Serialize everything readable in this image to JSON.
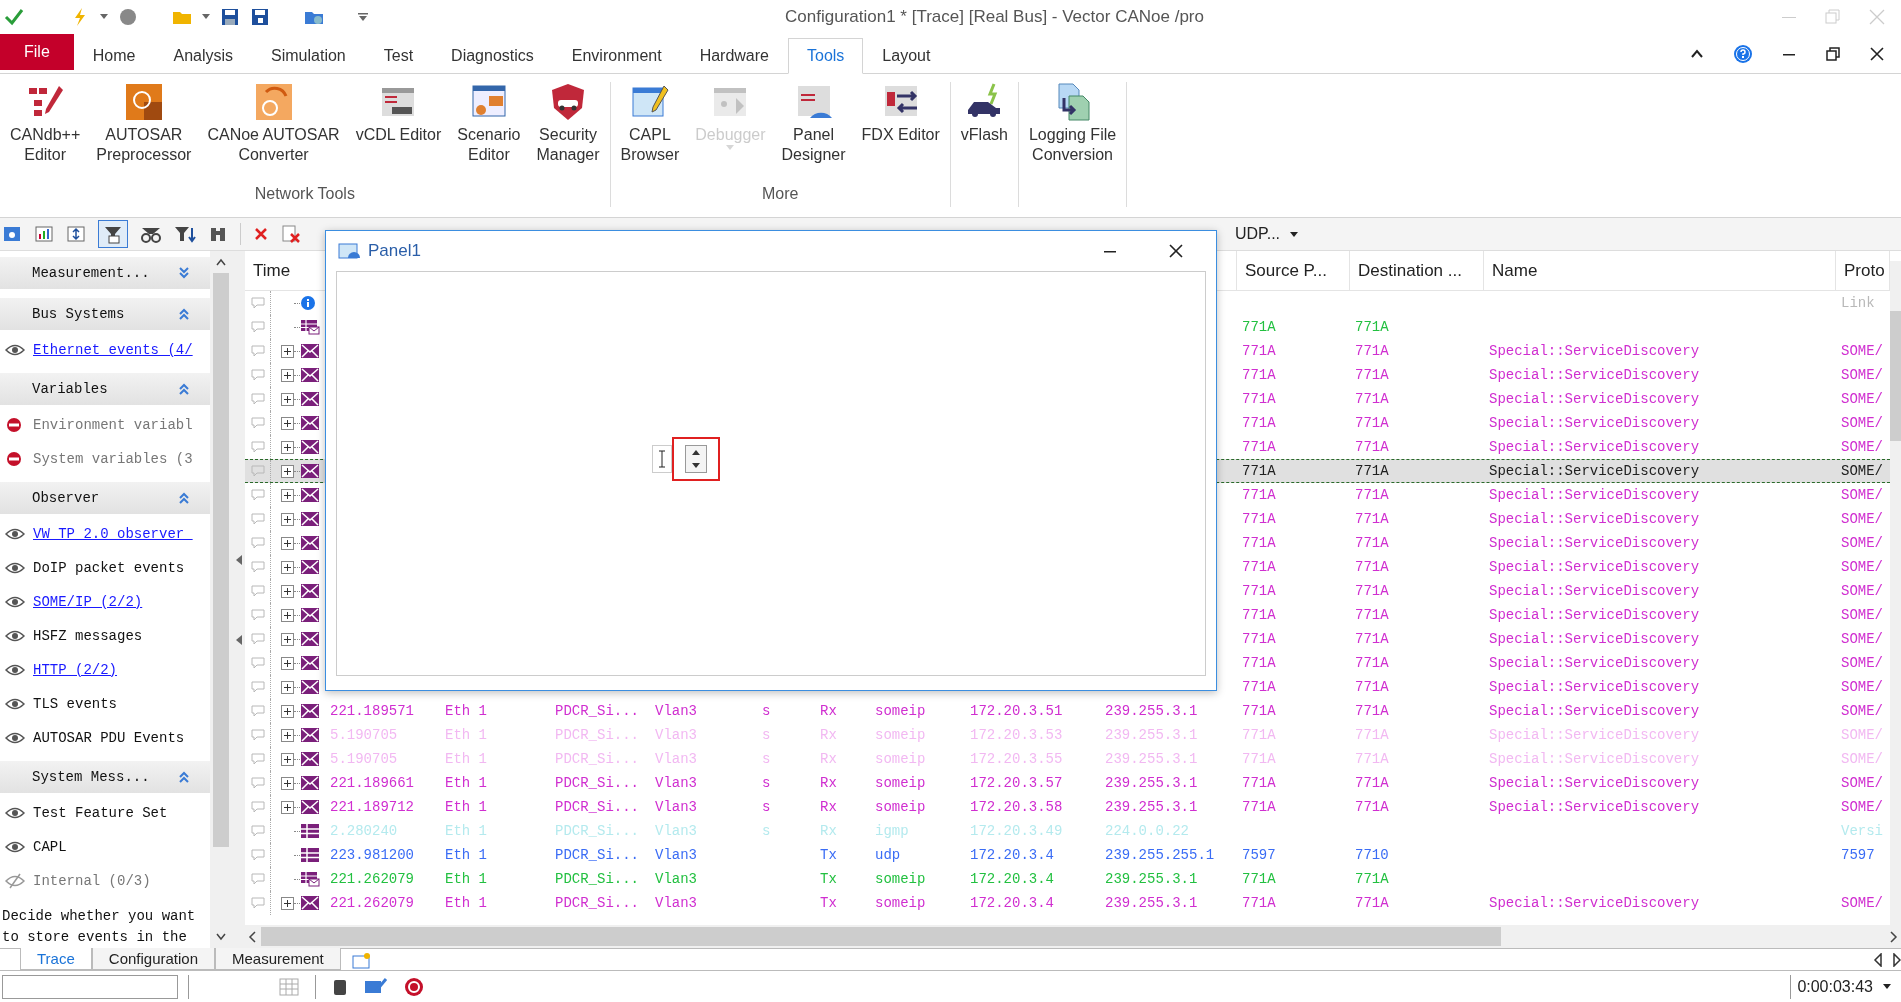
{
  "title_bar": {
    "title": "Configuration1 * [Trace] [Real Bus] - Vector CANoe /pro"
  },
  "ribbon_tabs": [
    {
      "label": "File",
      "kind": "backstage",
      "selected": false
    },
    {
      "label": "Home",
      "kind": "tab",
      "selected": false
    },
    {
      "label": "Analysis",
      "kind": "tab",
      "selected": false
    },
    {
      "label": "Simulation",
      "kind": "tab",
      "selected": false
    },
    {
      "label": "Test",
      "kind": "tab",
      "selected": false
    },
    {
      "label": "Diagnostics",
      "kind": "tab",
      "selected": false
    },
    {
      "label": "Environment",
      "kind": "tab",
      "selected": false
    },
    {
      "label": "Hardware",
      "kind": "tab",
      "selected": false
    },
    {
      "label": "Tools",
      "kind": "tab",
      "selected": true
    },
    {
      "label": "Layout",
      "kind": "tab",
      "selected": false
    }
  ],
  "ribbon_groups": [
    {
      "label": "Network Tools",
      "buttons": [
        {
          "lines": [
            "CANdb++",
            "Editor"
          ],
          "disabled": false
        },
        {
          "lines": [
            "AUTOSAR",
            "Preprocessor"
          ],
          "disabled": false
        },
        {
          "lines": [
            "CANoe AUTOSAR",
            "Converter"
          ],
          "disabled": false
        },
        {
          "lines": [
            "vCDL Editor"
          ],
          "disabled": false
        },
        {
          "lines": [
            "Scenario",
            "Editor"
          ],
          "disabled": false
        },
        {
          "lines": [
            "Security",
            "Manager"
          ],
          "disabled": false
        }
      ]
    },
    {
      "label": "More",
      "buttons": [
        {
          "lines": [
            "CAPL",
            "Browser"
          ],
          "disabled": false
        },
        {
          "lines": [
            "Debugger"
          ],
          "disabled": true
        },
        {
          "lines": [
            "Panel",
            "Designer"
          ],
          "disabled": false
        },
        {
          "lines": [
            "FDX Editor"
          ],
          "disabled": false
        }
      ]
    },
    {
      "buttons": [
        {
          "lines": [
            "vFlash"
          ],
          "disabled": false
        }
      ]
    },
    {
      "buttons": [
        {
          "lines": [
            "Logging File",
            "Conversion"
          ],
          "disabled": false
        }
      ]
    }
  ],
  "toolbar": {
    "dropdown": "UDP..."
  },
  "sidebar": {
    "sections": [
      {
        "title": "Measurement...",
        "expanded": false
      },
      {
        "title": "Bus Systems",
        "expanded": true,
        "items": [
          {
            "label": "Ethernet events (4/",
            "kind": "shown",
            "linked": true
          }
        ]
      },
      {
        "title": "Variables",
        "expanded": true,
        "items": [
          {
            "label": "Environment variabl",
            "kind": "excluded",
            "linked": false
          },
          {
            "label": "System variables (3",
            "kind": "excluded",
            "linked": false
          }
        ]
      },
      {
        "title": "Observer",
        "expanded": true,
        "items": [
          {
            "label": "VW TP 2.0 observer ",
            "kind": "shown",
            "linked": true
          },
          {
            "label": "DoIP packet events",
            "kind": "shown",
            "linked": false
          },
          {
            "label": "SOME/IP (2/2)",
            "kind": "shown",
            "linked": true
          },
          {
            "label": "HSFZ messages",
            "kind": "shown",
            "linked": false
          },
          {
            "label": "HTTP (2/2)",
            "kind": "shown",
            "linked": true
          },
          {
            "label": "TLS events",
            "kind": "shown",
            "linked": false
          },
          {
            "label": "AUTOSAR PDU Events",
            "kind": "shown",
            "linked": false
          }
        ]
      },
      {
        "title": "System Mess...",
        "expanded": true,
        "items": [
          {
            "label": "Test Feature Set",
            "kind": "shown",
            "linked": false
          },
          {
            "label": "CAPL",
            "kind": "shown",
            "linked": false
          },
          {
            "label": "Internal (0/3)",
            "kind": "hidden",
            "linked": false
          }
        ]
      }
    ],
    "description": "Decide whether you want to store events in the"
  },
  "trace_table": {
    "columns": [
      "Time",
      "Source P...",
      "Destination ...",
      "Name",
      "Proto"
    ],
    "rows": [
      {
        "kind": "info",
        "color": "#b8b8b8",
        "selected": false,
        "proto": "Link"
      },
      {
        "kind": "grid-envelope",
        "color": "#22c040",
        "selected": false,
        "source_port": "771A",
        "destination_port": "771A"
      },
      {
        "kind": "envelope",
        "color": "#d02ed0",
        "selected": false,
        "source_port": "771A",
        "destination_port": "771A",
        "name": "Special::ServiceDiscovery",
        "proto": "SOME/"
      },
      {
        "kind": "envelope",
        "color": "#d02ed0",
        "selected": false,
        "source_port": "771A",
        "destination_port": "771A",
        "name": "Special::ServiceDiscovery",
        "proto": "SOME/"
      },
      {
        "kind": "envelope",
        "color": "#d02ed0",
        "selected": false,
        "source_port": "771A",
        "destination_port": "771A",
        "name": "Special::ServiceDiscovery",
        "proto": "SOME/"
      },
      {
        "kind": "envelope",
        "color": "#d02ed0",
        "selected": false,
        "source_port": "771A",
        "destination_port": "771A",
        "name": "Special::ServiceDiscovery",
        "proto": "SOME/"
      },
      {
        "kind": "envelope",
        "color": "#d02ed0",
        "selected": false,
        "source_port": "771A",
        "destination_port": "771A",
        "name": "Special::ServiceDiscovery",
        "proto": "SOME/"
      },
      {
        "kind": "envelope",
        "color": "#202020",
        "selected": true,
        "source_port": "771A",
        "destination_port": "771A",
        "name": "Special::ServiceDiscovery",
        "proto": "SOME/"
      },
      {
        "kind": "envelope",
        "color": "#d02ed0",
        "selected": false,
        "source_port": "771A",
        "destination_port": "771A",
        "name": "Special::ServiceDiscovery",
        "proto": "SOME/"
      },
      {
        "kind": "envelope",
        "color": "#d02ed0",
        "selected": false,
        "source_port": "771A",
        "destination_port": "771A",
        "name": "Special::ServiceDiscovery",
        "proto": "SOME/"
      },
      {
        "kind": "envelope",
        "color": "#d02ed0",
        "selected": false,
        "source_port": "771A",
        "destination_port": "771A",
        "name": "Special::ServiceDiscovery",
        "proto": "SOME/"
      },
      {
        "kind": "envelope",
        "color": "#d02ed0",
        "selected": false,
        "source_port": "771A",
        "destination_port": "771A",
        "name": "Special::ServiceDiscovery",
        "proto": "SOME/"
      },
      {
        "kind": "envelope",
        "color": "#d02ed0",
        "selected": false,
        "source_port": "771A",
        "destination_port": "771A",
        "name": "Special::ServiceDiscovery",
        "proto": "SOME/"
      },
      {
        "kind": "envelope",
        "color": "#d02ed0",
        "selected": false,
        "source_port": "771A",
        "destination_port": "771A",
        "name": "Special::ServiceDiscovery",
        "proto": "SOME/"
      },
      {
        "kind": "envelope",
        "color": "#d02ed0",
        "selected": false,
        "source_port": "771A",
        "destination_port": "771A",
        "name": "Special::ServiceDiscovery",
        "proto": "SOME/"
      },
      {
        "kind": "envelope",
        "color": "#d02ed0",
        "selected": false,
        "source_port": "771A",
        "destination_port": "771A",
        "name": "Special::ServiceDiscovery",
        "proto": "SOME/"
      },
      {
        "kind": "envelope",
        "color": "#d02ed0",
        "selected": false,
        "source_port": "771A",
        "destination_port": "771A",
        "name": "Special::ServiceDiscovery",
        "proto": "SOME/"
      },
      {
        "kind": "envelope",
        "color": "#d02ed0",
        "selected": false,
        "time": "221.189571",
        "channel": "Eth 1",
        "id": "PDCR_Si...",
        "vlan": "Vlan3",
        "flag": "s",
        "dir": "Rx",
        "protocol": "someip",
        "source": "172.20.3.51",
        "destination": "239.255.3.1",
        "source_port": "771A",
        "destination_port": "771A",
        "name": "Special::ServiceDiscovery",
        "proto": "SOME/"
      },
      {
        "kind": "envelope",
        "color": "#f2b8f2",
        "selected": false,
        "time": "5.190705",
        "channel": "Eth 1",
        "id": "PDCR_Si...",
        "vlan": "Vlan3",
        "flag": "s",
        "dir": "Rx",
        "protocol": "someip",
        "source": "172.20.3.53",
        "destination": "239.255.3.1",
        "source_port": "771A",
        "destination_port": "771A",
        "name": "Special::ServiceDiscovery",
        "proto": "SOME/"
      },
      {
        "kind": "envelope",
        "color": "#f2b8f2",
        "selected": false,
        "time": "5.190705",
        "channel": "Eth 1",
        "id": "PDCR_Si...",
        "vlan": "Vlan3",
        "flag": "s",
        "dir": "Rx",
        "protocol": "someip",
        "source": "172.20.3.55",
        "destination": "239.255.3.1",
        "source_port": "771A",
        "destination_port": "771A",
        "name": "Special::ServiceDiscovery",
        "proto": "SOME/"
      },
      {
        "kind": "envelope",
        "color": "#d02ed0",
        "selected": false,
        "time": "221.189661",
        "channel": "Eth 1",
        "id": "PDCR_Si...",
        "vlan": "Vlan3",
        "flag": "s",
        "dir": "Rx",
        "protocol": "someip",
        "source": "172.20.3.57",
        "destination": "239.255.3.1",
        "source_port": "771A",
        "destination_port": "771A",
        "name": "Special::ServiceDiscovery",
        "proto": "SOME/"
      },
      {
        "kind": "envelope",
        "color": "#d02ed0",
        "selected": false,
        "time": "221.189712",
        "channel": "Eth 1",
        "id": "PDCR_Si...",
        "vlan": "Vlan3",
        "flag": "s",
        "dir": "Rx",
        "protocol": "someip",
        "source": "172.20.3.58",
        "destination": "239.255.3.1",
        "source_port": "771A",
        "destination_port": "771A",
        "name": "Special::ServiceDiscovery",
        "proto": "SOME/"
      },
      {
        "kind": "grid",
        "color": "#b4eaee",
        "selected": false,
        "time": "2.280240",
        "channel": "Eth 1",
        "id": "PDCR_Si...",
        "vlan": "Vlan3",
        "flag": "s",
        "dir": "Rx",
        "protocol": "igmp",
        "source": "172.20.3.49",
        "destination": "224.0.0.22",
        "proto": "Versi"
      },
      {
        "kind": "grid",
        "color": "#3a6cf5",
        "selected": false,
        "time": "223.981200",
        "channel": "Eth 1",
        "id": "PDCR_Si...",
        "vlan": "Vlan3",
        "dir": "Tx",
        "protocol": "udp",
        "source": "172.20.3.4",
        "destination": "239.255.255.1",
        "source_port": "7597",
        "destination_port": "7710",
        "proto": "7597"
      },
      {
        "kind": "grid-envelope",
        "color": "#22c040",
        "selected": false,
        "time": "221.262079",
        "channel": "Eth 1",
        "id": "PDCR_Si...",
        "vlan": "Vlan3",
        "dir": "Tx",
        "protocol": "someip",
        "source": "172.20.3.4",
        "destination": "239.255.3.1",
        "source_port": "771A",
        "destination_port": "771A"
      },
      {
        "kind": "envelope",
        "color": "#d02ed0",
        "selected": false,
        "time": "221.262079",
        "channel": "Eth 1",
        "id": "PDCR_Si...",
        "vlan": "Vlan3",
        "dir": "Tx",
        "protocol": "someip",
        "source": "172.20.3.4",
        "destination": "239.255.3.1",
        "source_port": "771A",
        "destination_port": "771A",
        "name": "Special::ServiceDiscovery",
        "proto": "SOME/"
      }
    ]
  },
  "panel_window": {
    "title": "Panel1",
    "spin_control": {
      "selected": true
    }
  },
  "bottom_tabs": [
    {
      "label": "Trace",
      "selected": true
    },
    {
      "label": "Configuration",
      "selected": false
    },
    {
      "label": "Measurement",
      "selected": false
    }
  ],
  "status_bar": {
    "time": "0:00:03:43"
  }
}
